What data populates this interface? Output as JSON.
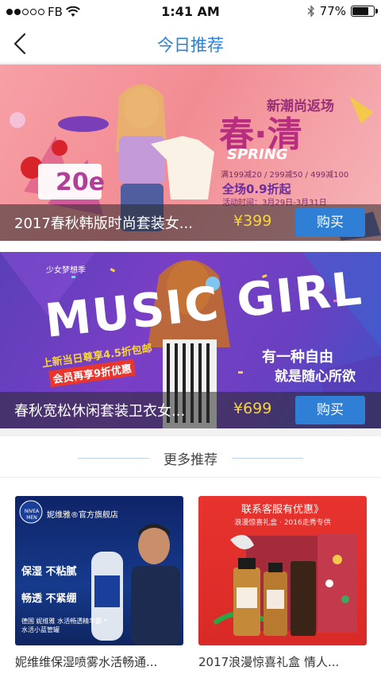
{
  "status_bar": {
    "carrier": "FB",
    "time": "1:41 AM",
    "battery_percent": "77%",
    "battery_level": 0.77
  },
  "nav": {
    "title": "今日推荐"
  },
  "banners": [
    {
      "name": "2017春秋韩版时尚套装女...",
      "price": "¥399",
      "buy_label": "购买",
      "art": {
        "headline": "春·清",
        "subhead": "新潮尚返场",
        "season": "SPRING",
        "discount": "全场0.9折起",
        "price_tag": "20e",
        "promo_line": "满199减20 / 299减50 / 499减100",
        "date_line": "活动时间：3月29日-3月31日"
      }
    },
    {
      "name": "春秋宽松休闲套装卫衣女...",
      "price": "¥699",
      "buy_label": "购买",
      "art": {
        "headline": "MUSIC GIRL",
        "tagline_1": "有一种自由",
        "tagline_2": "就是随心所欲",
        "promo_1": "上新当日尊享4.5折包邮",
        "promo_2": "会员再享9折优惠",
        "small_top": "少女梦想季"
      }
    }
  ],
  "more": {
    "title": "更多推荐"
  },
  "products": [
    {
      "name": "妮维维保湿喷雾水活畅通...",
      "art": {
        "brand": "NIVEA MEN",
        "store": "妮维雅®官方旗舰店",
        "tag_1": "保湿 不粘腻",
        "tag_2": "畅透 不紧绷",
        "footer": "德国 妮维雅 水活畅透精华露 *水活小蓝管罐"
      }
    },
    {
      "name": "2017浪漫惊喜礼盒 情人...",
      "art": {
        "headline": "联系客服有优惠》",
        "subline": "浪漫惊喜礼盒 · 2016走秀专供"
      }
    }
  ],
  "colors": {
    "accent": "#2f7fd6",
    "price": "#f7d43c"
  }
}
